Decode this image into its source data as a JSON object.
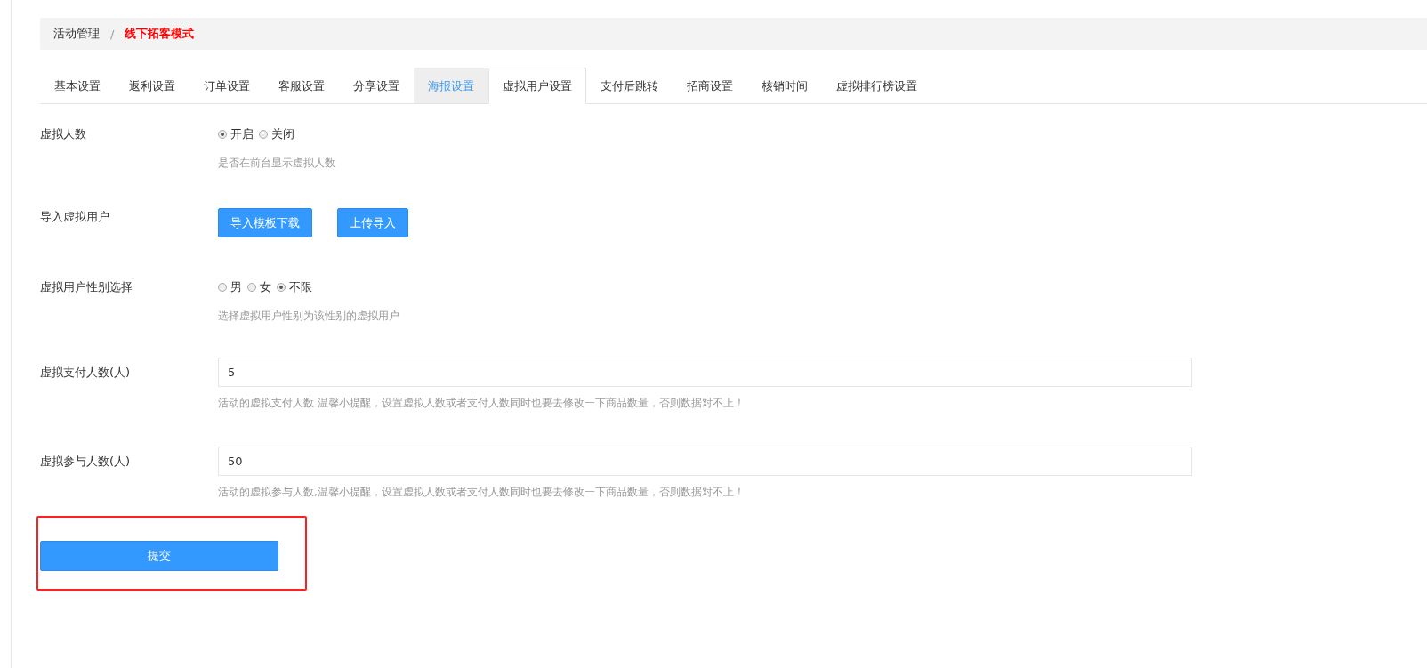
{
  "breadcrumb": [
    {
      "label": "活动管理"
    },
    {
      "label": "线下拓客模式"
    }
  ],
  "breadcrumb_separator": "/",
  "tabs": [
    {
      "label": "基本设置",
      "selected": false,
      "hovered": false
    },
    {
      "label": "返利设置",
      "selected": false,
      "hovered": false
    },
    {
      "label": "订单设置",
      "selected": false,
      "hovered": false
    },
    {
      "label": "客服设置",
      "selected": false,
      "hovered": false
    },
    {
      "label": "分享设置",
      "selected": false,
      "hovered": false
    },
    {
      "label": "海报设置",
      "selected": false,
      "hovered": true
    },
    {
      "label": "虚拟用户设置",
      "selected": true,
      "hovered": false
    },
    {
      "label": "支付后跳转",
      "selected": false,
      "hovered": false
    },
    {
      "label": "招商设置",
      "selected": false,
      "hovered": false
    },
    {
      "label": "核销时间",
      "selected": false,
      "hovered": false
    },
    {
      "label": "虚拟排行榜设置",
      "selected": false,
      "hovered": false
    }
  ],
  "fields": [
    {
      "kind": "radio",
      "label": "虚拟人数",
      "options": [
        {
          "label": "开启",
          "selected": true
        },
        {
          "label": "关闭",
          "selected": false
        }
      ],
      "help": "是否在前台显示虚拟人数"
    },
    {
      "kind": "buttons",
      "label": "导入虚拟用户",
      "buttons": [
        "导入模板下载",
        "上传导入"
      ]
    },
    {
      "kind": "radio",
      "label": "虚拟用户性别选择",
      "options": [
        {
          "label": "男",
          "selected": false
        },
        {
          "label": "女",
          "selected": false
        },
        {
          "label": "不限",
          "selected": true
        }
      ],
      "help": "选择虚拟用户性别为该性别的虚拟用户"
    },
    {
      "kind": "input",
      "label": "虚拟支付人数(人)",
      "value": "5",
      "help": "活动的虚拟支付人数 温馨小提醒，设置虚拟人数或者支付人数同时也要去修改一下商品数量，否则数据对不上！"
    },
    {
      "kind": "input",
      "label": "虚拟参与人数(人)",
      "value": "50",
      "help": "活动的虚拟参与人数,温馨小提醒，设置虚拟人数或者支付人数同时也要去修改一下商品数量，否则数据对不上！"
    }
  ],
  "submit": "提交"
}
